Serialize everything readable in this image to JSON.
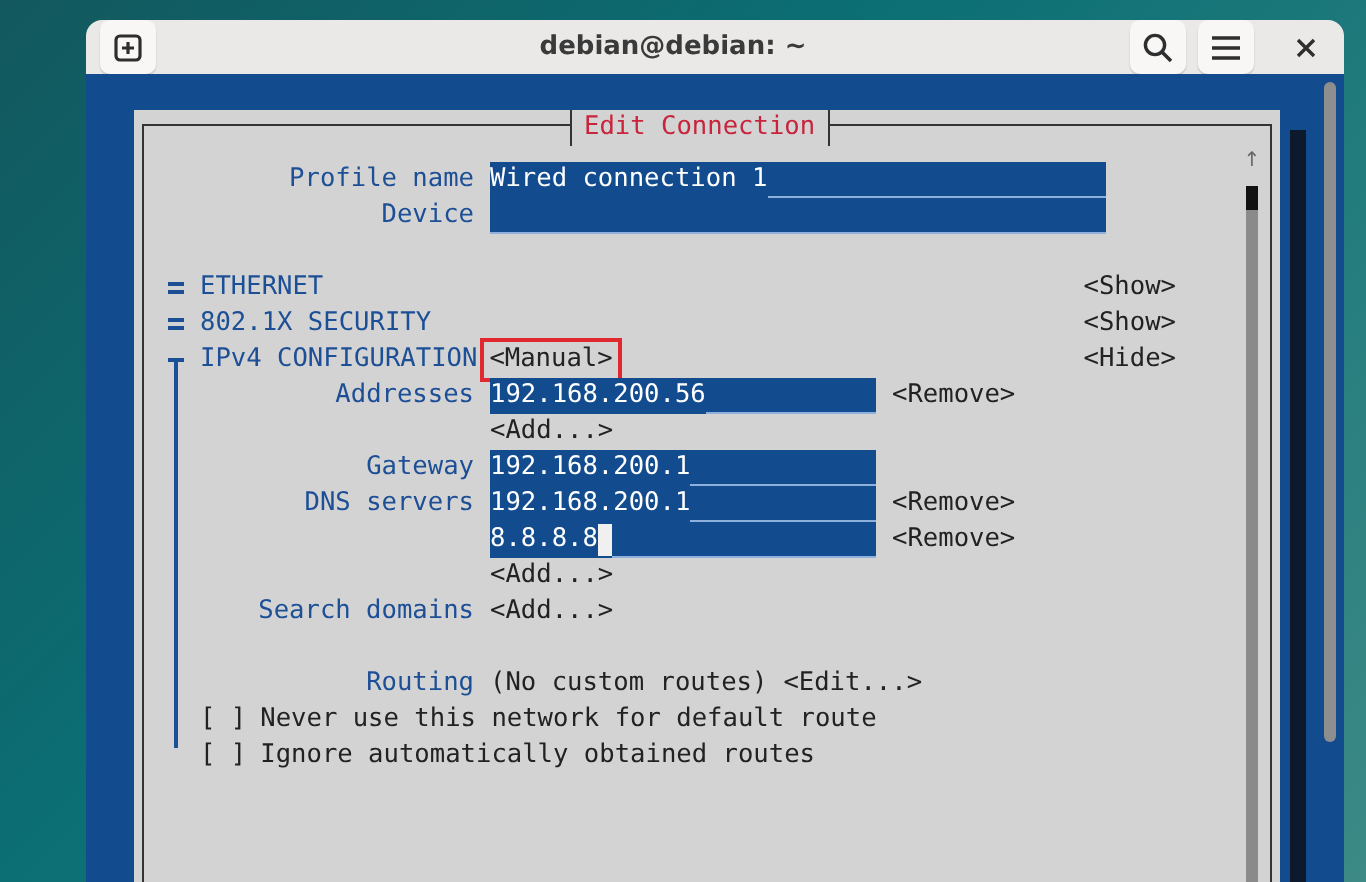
{
  "window": {
    "title": "debian@debian: ~"
  },
  "dialog": {
    "title": "Edit Connection"
  },
  "fields": [
    {
      "label": "Profile name",
      "value": "Wired connection 1"
    },
    {
      "label": "Device"
    }
  ],
  "sections": [
    {
      "label": "ETHERNET",
      "expanded": false,
      "toggle": "<Show>"
    },
    {
      "label": "802.1X SECURITY",
      "expanded": false,
      "toggle": "<Show>"
    },
    {
      "label": "IPv4 CONFIGURATION",
      "expanded": true,
      "mode": "<Manual>",
      "mode_highlighted": true,
      "toggle": "<Hide>",
      "rows": [
        {
          "kind": "field",
          "label": "Addresses",
          "value": "192.168.200.56",
          "focused": false,
          "button": "<Remove>"
        },
        {
          "kind": "button",
          "button": "<Add...>"
        },
        {
          "kind": "field",
          "label": "Gateway",
          "value": "192.168.200.1",
          "focused": false
        },
        {
          "kind": "field",
          "label": "DNS servers",
          "value": "192.168.200.1",
          "focused": false,
          "button": "<Remove>"
        },
        {
          "kind": "field",
          "value": "8.8.8.8",
          "focused": true,
          "button": "<Remove>"
        },
        {
          "kind": "button",
          "button": "<Add...>"
        },
        {
          "kind": "button",
          "label": "Search domains",
          "button": "<Add...>"
        },
        {
          "kind": "blank"
        },
        {
          "kind": "text",
          "label": "Routing",
          "text": "(No custom routes)",
          "button": "<Edit...>"
        },
        {
          "kind": "checkbox",
          "checked": false,
          "box": "[ ]",
          "label": "Never use this network for default route"
        },
        {
          "kind": "checkbox",
          "checked": false,
          "box": "[ ]",
          "label": "Ignore automatically obtained routes"
        }
      ]
    }
  ],
  "scroll_arrow": "↑"
}
